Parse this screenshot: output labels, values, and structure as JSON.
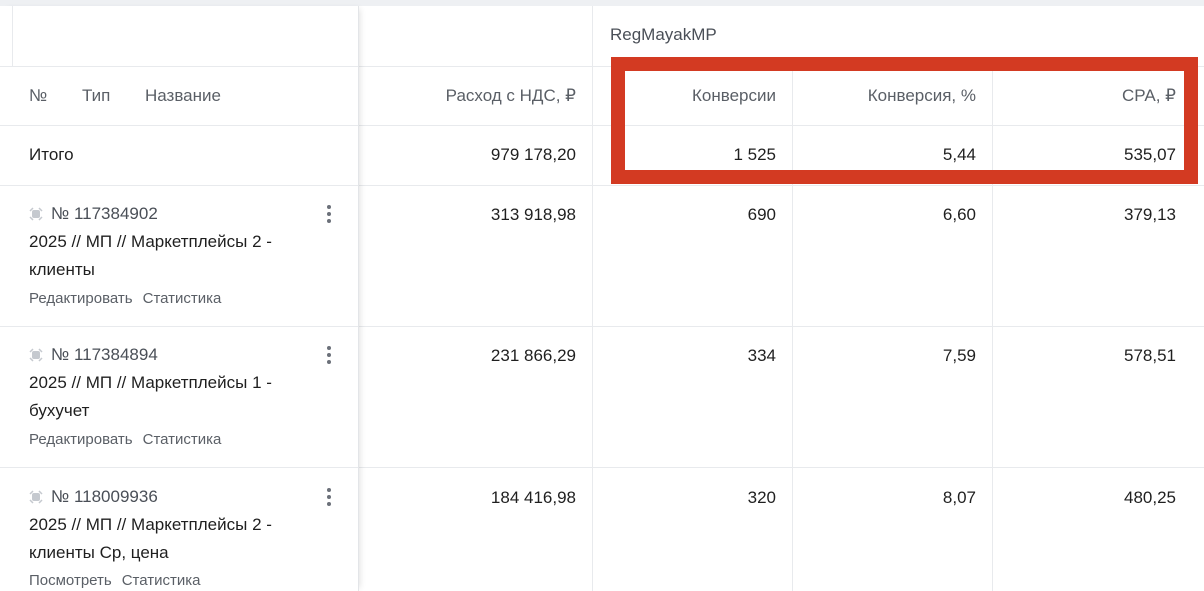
{
  "group_label": "RegMayakMP",
  "headers": {
    "num": "№",
    "type": "Тип",
    "name": "Название",
    "spend": "Расход с НДС, ₽",
    "conversions": "Конверсии",
    "conversion_rate": "Конверсия, %",
    "cpa": "CPA, ₽"
  },
  "totals": {
    "label": "Итого",
    "spend": "979 178,20",
    "conversions": "1 525",
    "conversion_rate": "5,44",
    "cpa": "535,07"
  },
  "rows": [
    {
      "id": "№ 117384902",
      "name": "2025 // МП // Маркетплейсы 2 - клиенты",
      "link1": "Редактировать",
      "link2": "Статистика",
      "spend": "313 918,98",
      "conversions": "690",
      "conversion_rate": "6,60",
      "cpa": "379,13"
    },
    {
      "id": "№ 117384894",
      "name": "2025 // МП // Маркетплейсы 1 - бухучет",
      "link1": "Редактировать",
      "link2": "Статистика",
      "spend": "231 866,29",
      "conversions": "334",
      "conversion_rate": "7,59",
      "cpa": "578,51"
    },
    {
      "id": "№ 118009936",
      "name": "2025 // МП // Маркетплейсы 2 - клиенты Ср, цена",
      "link1": "Посмотреть",
      "link2": "Статистика",
      "spend": "184 416,98",
      "conversions": "320",
      "conversion_rate": "8,07",
      "cpa": "480,25"
    }
  ],
  "colors": {
    "highlight": "#d33a22",
    "grid": "#e8eaed",
    "muted_text": "#5a5f66"
  },
  "icons": {
    "status": "campaign-status-icon",
    "menu": "kebab-menu-icon"
  }
}
